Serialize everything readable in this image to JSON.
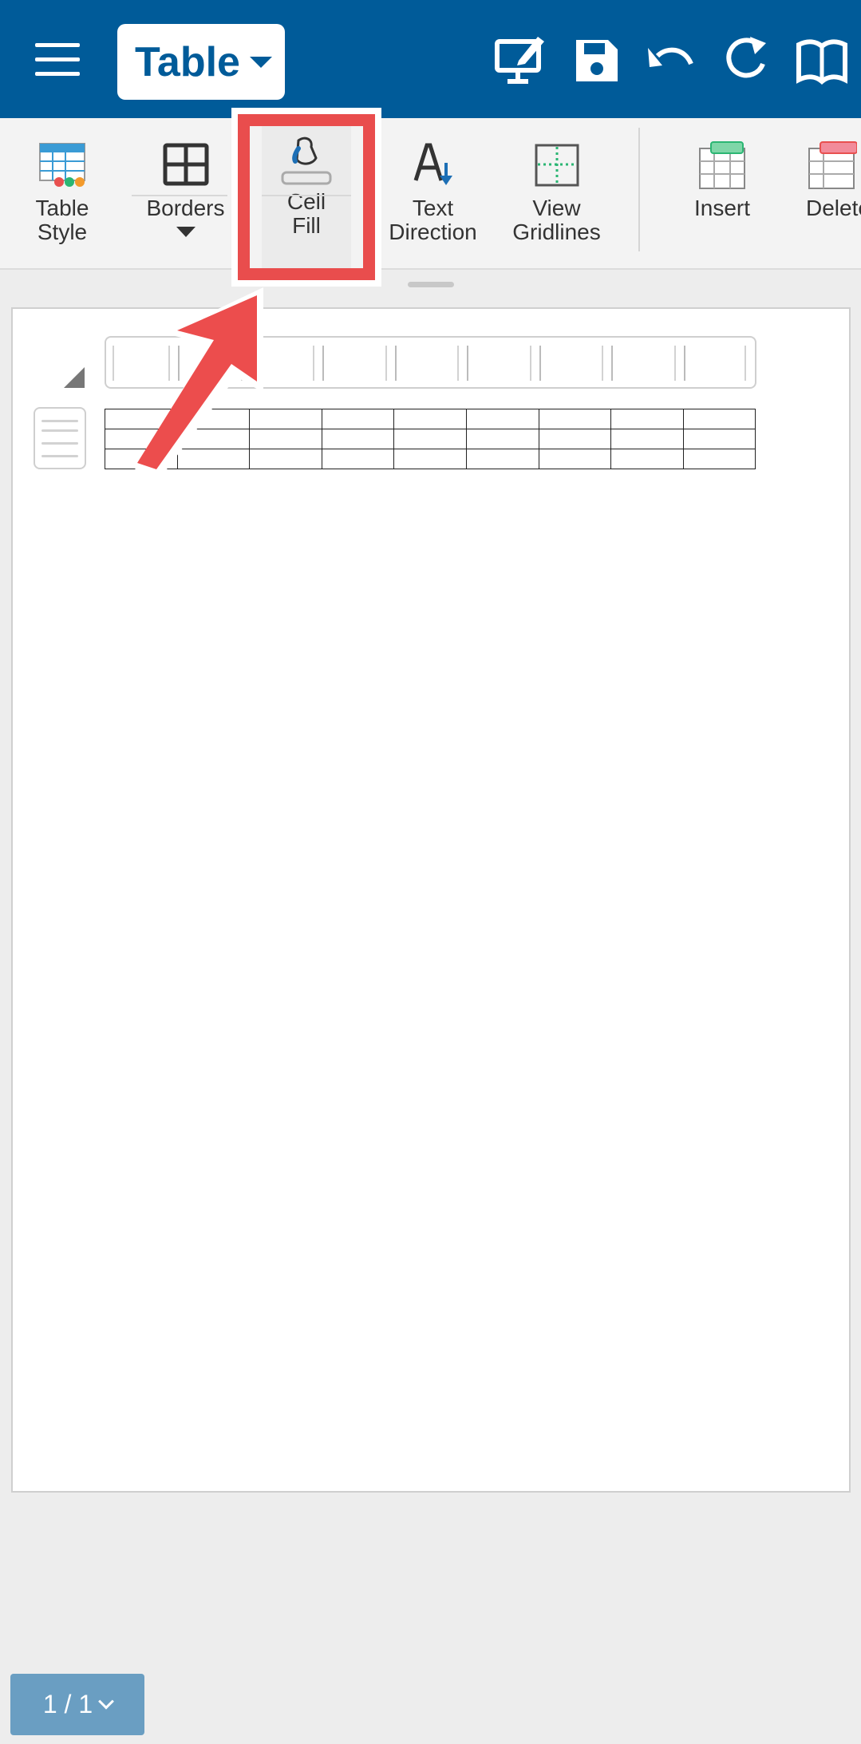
{
  "header": {
    "mode_label": "Table",
    "icons": [
      "menu-icon",
      "presentation-edit-icon",
      "save-icon",
      "undo-icon",
      "redo-icon",
      "read-mode-icon"
    ]
  },
  "ribbon": {
    "table_style": "Table\nStyle",
    "borders": "Borders",
    "cell_fill": "Cell\nFill",
    "text_direction": "Text\nDirection",
    "view_gridlines": "View\nGridlines",
    "insert": "Insert",
    "delete": "Delete"
  },
  "document": {
    "table_columns": 9,
    "table_rows": 3
  },
  "footer": {
    "page_indicator": "1 / 1"
  },
  "colors": {
    "header": "#005b99",
    "highlight": "#e94d4d",
    "page_indicator": "#6a9ec2"
  }
}
